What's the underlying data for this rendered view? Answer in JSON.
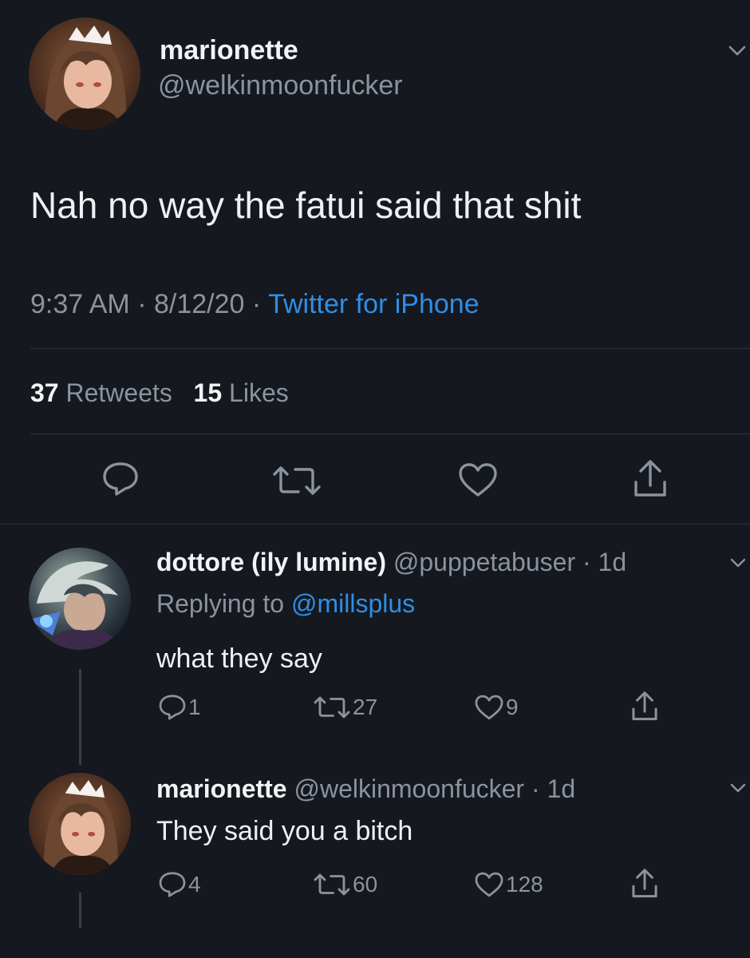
{
  "main_tweet": {
    "display_name": "marionette",
    "handle": "@welkinmoonfucker",
    "text": "Nah no way the fatui said that shit",
    "time": "9:37 AM",
    "date": "8/12/20",
    "separator": "·",
    "client": "Twitter for iPhone",
    "retweets_count": "37",
    "retweets_label": "Retweets",
    "likes_count": "15",
    "likes_label": "Likes"
  },
  "reply_1": {
    "display_name": "dottore (ily lumine)",
    "handle": "@puppetabuser",
    "time_ago": "· 1d",
    "replying_prefix": "Replying to",
    "replying_to": "@millsplus",
    "text": "what they say",
    "replies": "1",
    "retweets": "27",
    "likes": "9"
  },
  "reply_2": {
    "display_name": "marionette",
    "handle": "@welkinmoonfucker",
    "time_ago": "· 1d",
    "text": "They said you a bitch",
    "replies": "4",
    "retweets": "60",
    "likes": "128"
  },
  "icons": {
    "reply": "reply-icon",
    "retweet": "retweet-icon",
    "like": "heart-icon",
    "share": "share-icon",
    "more": "chevron-down-icon"
  },
  "colors": {
    "background": "#15181f",
    "link": "#2f8ee6",
    "muted": "#8b939d"
  }
}
